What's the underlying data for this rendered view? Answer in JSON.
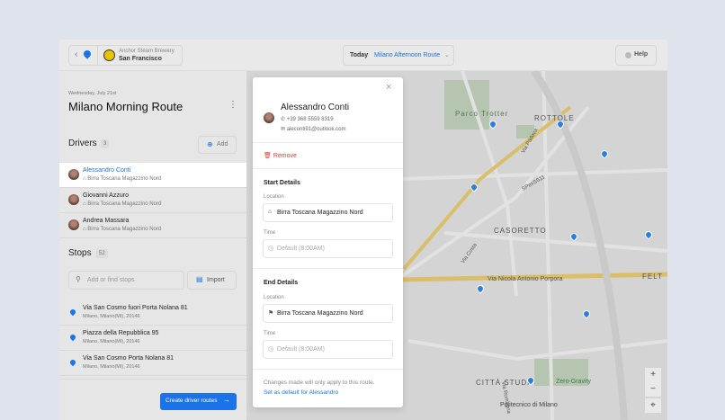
{
  "header": {
    "org_name": "Anchor Steam Brewery",
    "org_city": "San Francisco",
    "date_label": "Today",
    "route_select": "Milano Afternoon Route",
    "help": "Help"
  },
  "route": {
    "date": "Wednesday, July 21st",
    "title": "Milano Morning Route"
  },
  "drivers": {
    "title": "Drivers",
    "count": "3",
    "add": "Add",
    "items": [
      {
        "name": "Alessandro Conti",
        "depot": "Birra Toscana Magazzino Nord"
      },
      {
        "name": "Giovanni Azzuro",
        "depot": "Birra Toscana Magazzino Nord"
      },
      {
        "name": "Andrea Massara",
        "depot": "Birra Toscana Magazzino Nord"
      }
    ]
  },
  "stops": {
    "title": "Stops",
    "count": "52",
    "search_placeholder": "Add or find stops",
    "import": "Import",
    "items": [
      {
        "address": "Via San Cosmo fuori Porta Nolana 81",
        "city": "Milano, Milano(MI), 20146"
      },
      {
        "address": "Piazza della Repubblica 95",
        "city": "Milano, Milano(MI), 20146"
      },
      {
        "address": "Via San Cosmo Porta Nolana 81",
        "city": "Milano, Milano(MI), 20146"
      }
    ]
  },
  "create_routes": "Create driver routes",
  "panel": {
    "name": "Alessandro Conti",
    "phone": "+39 368 5559 8319",
    "email": "aleconti91@outlook.com",
    "remove": "Remove",
    "start": {
      "title": "Start Details",
      "location_label": "Location",
      "location": "Birra Toscana Magazzino Nord",
      "time_label": "Time",
      "time": "Default (8:00AM)"
    },
    "end": {
      "title": "End Details",
      "location_label": "Location",
      "location": "Birra Toscana Magazzino Nord",
      "time_label": "Time",
      "time": "Default (8:00AM)"
    },
    "note": "Changes made will only apply to this route.",
    "default_link": "Set as default for Alessandro"
  },
  "map": {
    "labels": [
      "Parco Trotter",
      "ROTTOLE",
      "CASORETTO",
      "Via Nicola Antonio Porpora",
      "FELT",
      "CITTÀ STUDI",
      "Politecnico di Milano",
      "Zero-Gravity",
      "SPexSS11",
      "Via Padova",
      "Via Costa",
      "Via Romagna"
    ]
  },
  "colors": {
    "accent": "#1a73e8",
    "danger": "#e53935"
  }
}
